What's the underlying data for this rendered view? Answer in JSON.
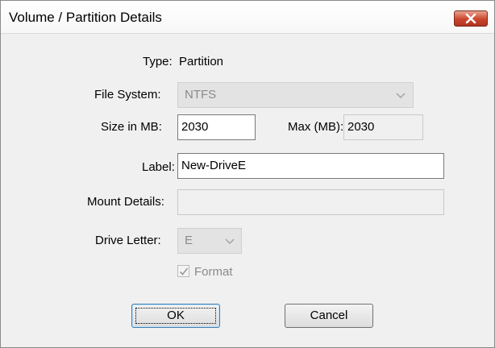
{
  "window": {
    "title": "Volume / Partition Details"
  },
  "form": {
    "type_label": "Type:",
    "type_value": "Partition",
    "filesystem_label": "File System:",
    "filesystem_value": "NTFS",
    "size_label": "Size in MB:",
    "size_value": "2030",
    "max_label": "Max (MB):",
    "max_value": "2030",
    "label_label": "Label:",
    "label_value": "New-DriveE",
    "mount_label": "Mount Details:",
    "mount_value": "",
    "drive_letter_label": "Drive Letter:",
    "drive_letter_value": "E",
    "format_label": "Format",
    "format_checked": true
  },
  "buttons": {
    "ok": "OK",
    "cancel": "Cancel"
  },
  "colors": {
    "close_button": "#c9462c",
    "default_button_border": "#3c7fb1"
  },
  "icons": {
    "close": "close-icon",
    "dropdown": "chevron-down-icon",
    "check": "checkmark-icon"
  }
}
